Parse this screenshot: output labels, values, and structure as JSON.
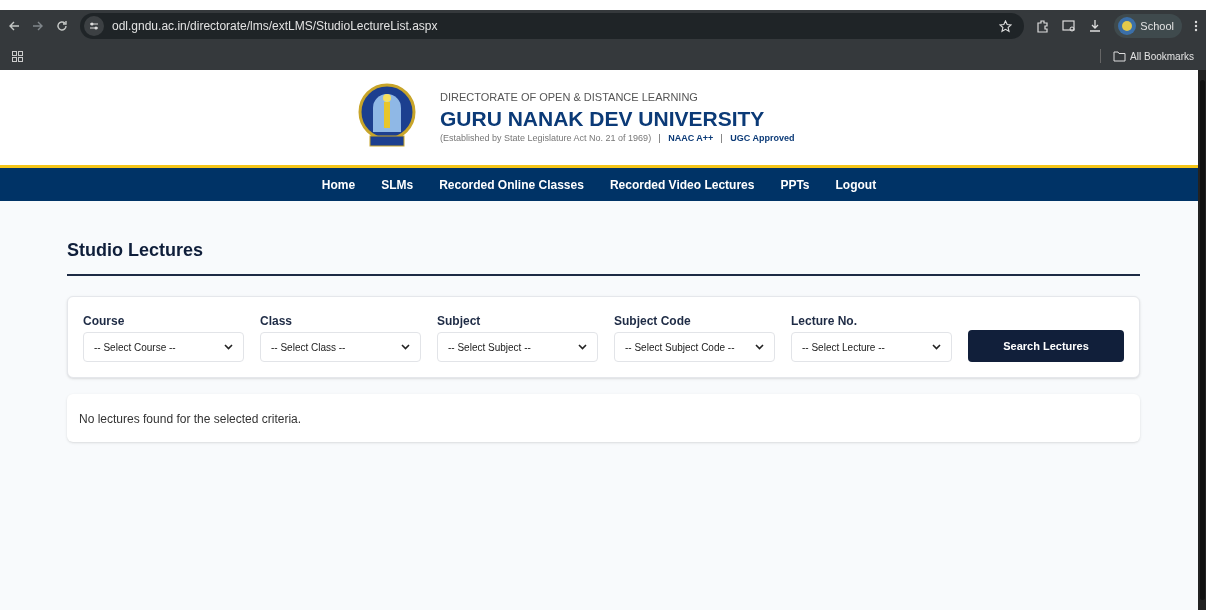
{
  "browser": {
    "url": "odl.gndu.ac.in/directorate/lms/extLMS/StudioLectureList.aspx",
    "profile": "School",
    "bookmarks": "All Bookmarks"
  },
  "header": {
    "overline": "DIRECTORATE OF OPEN & DISTANCE LEARNING",
    "title": "GURU NANAK DEV UNIVERSITY",
    "established": "(Established by State Legislature Act No. 21 of 1969)",
    "badges": [
      "NAAC A++",
      "UGC Approved"
    ]
  },
  "nav": [
    "Home",
    "SLMs",
    "Recorded Online Classes",
    "Recorded Video Lectures",
    "PPTs",
    "Logout"
  ],
  "page_title": "Studio Lectures",
  "filters": [
    {
      "label": "Course",
      "value": "-- Select Course --"
    },
    {
      "label": "Class",
      "value": "-- Select Class --"
    },
    {
      "label": "Subject",
      "value": "-- Select Subject --"
    },
    {
      "label": "Subject Code",
      "value": "-- Select Subject Code --"
    },
    {
      "label": "Lecture No.",
      "value": "-- Select Lecture --"
    }
  ],
  "search_button": "Search Lectures",
  "message": "No lectures found for the selected criteria."
}
